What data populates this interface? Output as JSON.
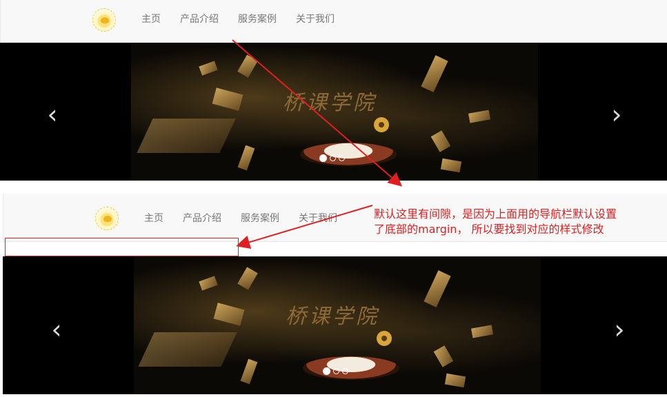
{
  "nav_top": {
    "items": [
      "主页",
      "产品介绍",
      "服务案例",
      "关于我们"
    ]
  },
  "carousel_top": {
    "banner_title": "桥课学院",
    "indicators": 3,
    "active_index": 0
  },
  "nav_bottom": {
    "items": [
      "主页",
      "产品介绍",
      "服务案例",
      "关于我们"
    ]
  },
  "carousel_bottom": {
    "banner_title": "桥课学院",
    "indicators": 3,
    "active_index": 0
  },
  "annotation": {
    "line1": "默认这里有间隙，是因为上面用的导航栏默认设置",
    "line2": "了底部的margin， 所以要找到对应的样式修改",
    "color": "#e02020"
  },
  "icons": {
    "prev": "chevron-left-icon",
    "next": "chevron-right-icon",
    "logo": "duck-logo-icon"
  }
}
